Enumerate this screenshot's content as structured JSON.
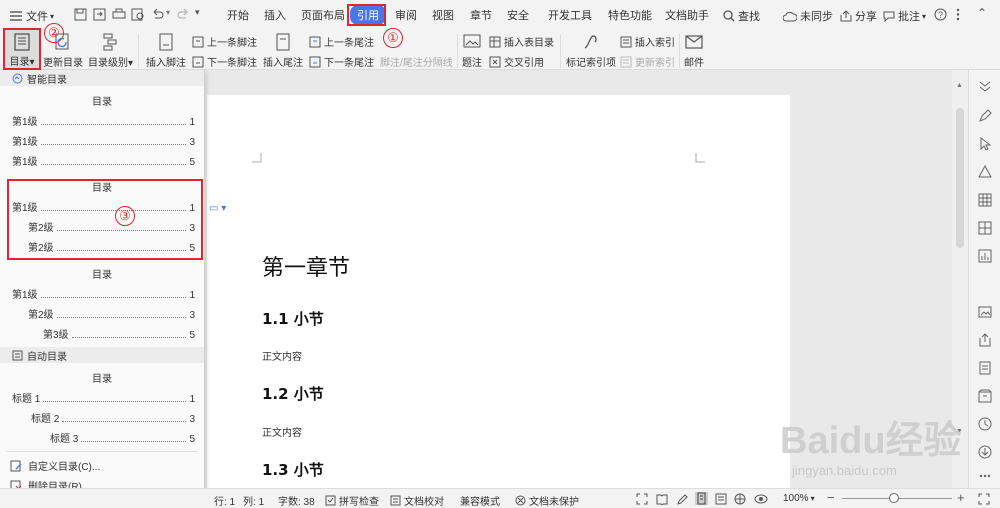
{
  "menubar": {
    "file_label": "文件",
    "tabs": [
      "开始",
      "插入",
      "页面布局",
      "引用",
      "审阅",
      "视图",
      "章节",
      "安全",
      "开发工具",
      "特色功能",
      "文档助手"
    ],
    "active_tab": "引用",
    "search_label": "查找",
    "sync_label": "未同步",
    "share_label": "分享",
    "comment_label": "批注"
  },
  "ribbon": {
    "toc": "目录",
    "update_toc": "更新目录",
    "toc_level": "目录级别",
    "insert_footnote": "插入脚注",
    "prev_footnote": "上一条脚注",
    "next_footnote": "下一条脚注",
    "insert_endnote": "插入尾注",
    "prev_endnote": "上一条尾注",
    "next_endnote": "下一条尾注",
    "separator_line": "脚注/尾注分隔线",
    "caption": "题注",
    "insert_table_toc": "插入表目录",
    "cross_ref": "交叉引用",
    "mark_index": "标记索引项",
    "insert_index": "插入索引",
    "update_index": "更新索引",
    "mail": "邮件"
  },
  "annotations": {
    "c1": "①",
    "c2": "②",
    "c3": "③"
  },
  "dropdown": {
    "smart_toc_header": "智能目录",
    "block1": {
      "title": "目录",
      "items": [
        {
          "label": "第1级",
          "page": "1"
        },
        {
          "label": "第1级",
          "page": "3"
        },
        {
          "label": "第1级",
          "page": "5"
        }
      ]
    },
    "block2": {
      "title": "目录",
      "items": [
        {
          "label": "第1级",
          "page": "1"
        },
        {
          "label": "第2级",
          "page": "3"
        },
        {
          "label": "第2级",
          "page": "5"
        }
      ]
    },
    "block3": {
      "title": "目录",
      "items": [
        {
          "label": "第1级",
          "page": "1"
        },
        {
          "label": "第2级",
          "page": "3"
        },
        {
          "label": "第3级",
          "page": "5"
        }
      ]
    },
    "auto_toc_header": "自动目录",
    "block4": {
      "title": "目录",
      "items": [
        {
          "label": "标题 1",
          "page": "1"
        },
        {
          "label": "标题 2",
          "page": "3"
        },
        {
          "label": "标题 3",
          "page": "5"
        }
      ]
    },
    "custom_toc": "自定义目录(C)...",
    "delete_toc": "删除目录(R)"
  },
  "document": {
    "chapter": "第一章节",
    "sections": [
      {
        "heading": "1.1 小节",
        "body": "正文内容"
      },
      {
        "heading": "1.2 小节",
        "body": "正文内容"
      },
      {
        "heading": "1.3 小节",
        "body": ""
      }
    ]
  },
  "statusbar": {
    "row": "行: 1",
    "col": "列: 1",
    "words": "字数: 38",
    "spellcheck": "拼写检查",
    "doc_check": "文档校对",
    "compat": "兼容模式",
    "unprotected": "文档未保护",
    "zoom": "100%"
  },
  "watermark": {
    "brand": "Baidu经验",
    "url": "jingyan.baidu.com"
  },
  "colors": {
    "accent": "#4a76e8",
    "highlight": "#e0262d"
  }
}
